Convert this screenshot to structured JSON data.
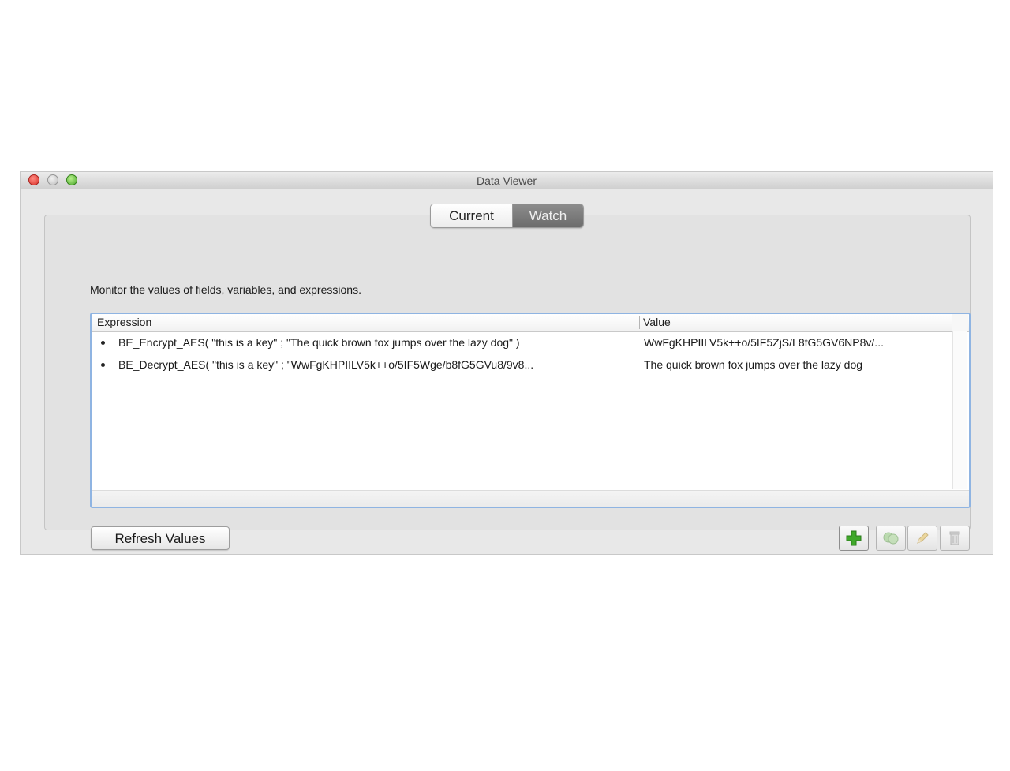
{
  "window": {
    "title": "Data Viewer"
  },
  "tabs": [
    {
      "label": "Current",
      "selected": false
    },
    {
      "label": "Watch",
      "selected": true
    }
  ],
  "description": "Monitor the values of fields, variables, and expressions.",
  "table": {
    "columns": [
      "Expression",
      "Value"
    ],
    "rows": [
      {
        "expression": "BE_Encrypt_AES( \"this is a key\" ; \"The quick brown fox jumps over the lazy dog\" )",
        "value": "WwFgKHPIILV5k++o/5IF5ZjS/L8fG5GV6NP8v/..."
      },
      {
        "expression": "BE_Decrypt_AES( \"this is a key\" ; \"WwFgKHPIILV5k++o/5IF5Wge/b8fG5GVu8/9v8...",
        "value": "The quick brown fox jumps over the lazy dog"
      }
    ]
  },
  "buttons": {
    "refresh_label": "Refresh Values"
  },
  "toolbar": {
    "icons": [
      "add-icon",
      "duplicate-icon",
      "edit-pencil-icon",
      "delete-trash-icon"
    ]
  },
  "colors": {
    "close": "#d9302a",
    "minimize": "#bdbdbd",
    "zoom": "#4ca72d",
    "selected_tab": "#7a7a7a",
    "table_focus_border": "#8fb4e2",
    "add_icon": "#3fa82a"
  }
}
